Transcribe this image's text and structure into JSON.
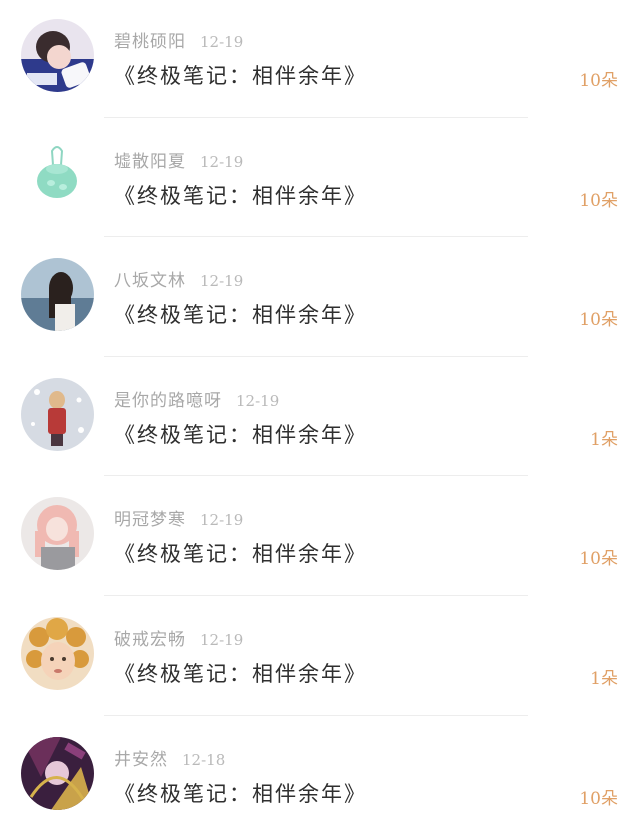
{
  "gifts": [
    {
      "username": "碧桃硕阳",
      "date": "12-19",
      "book": "《终极笔记：相伴余年》",
      "amount": "10朵",
      "avatar": "avatar-girl-icon"
    },
    {
      "username": "墟散阳夏",
      "date": "12-19",
      "book": "《终极笔记：相伴余年》",
      "amount": "10朵",
      "avatar": "green-bag-icon"
    },
    {
      "username": "八坂文林",
      "date": "12-19",
      "book": "《终极笔记：相伴余年》",
      "amount": "10朵",
      "avatar": "girl-seaside-icon"
    },
    {
      "username": "是你的路噫呀",
      "date": "12-19",
      "book": "《终极笔记：相伴余年》",
      "amount": "1朵",
      "avatar": "winter-figure-icon"
    },
    {
      "username": "明冠梦寒",
      "date": "12-19",
      "book": "《终极笔记：相伴余年》",
      "amount": "10朵",
      "avatar": "pink-hair-girl-icon"
    },
    {
      "username": "破戒宏畅",
      "date": "12-19",
      "book": "《终极笔记：相伴余年》",
      "amount": "1朵",
      "avatar": "curly-hair-child-icon"
    },
    {
      "username": "井安然",
      "date": "12-18",
      "book": "《终极笔记：相伴余年》",
      "amount": "10朵",
      "avatar": "anime-art-icon"
    }
  ],
  "colors": {
    "amount": "#e0a066",
    "username": "#a8a8a8",
    "book": "#2f2f2f",
    "divider": "#ededed"
  }
}
